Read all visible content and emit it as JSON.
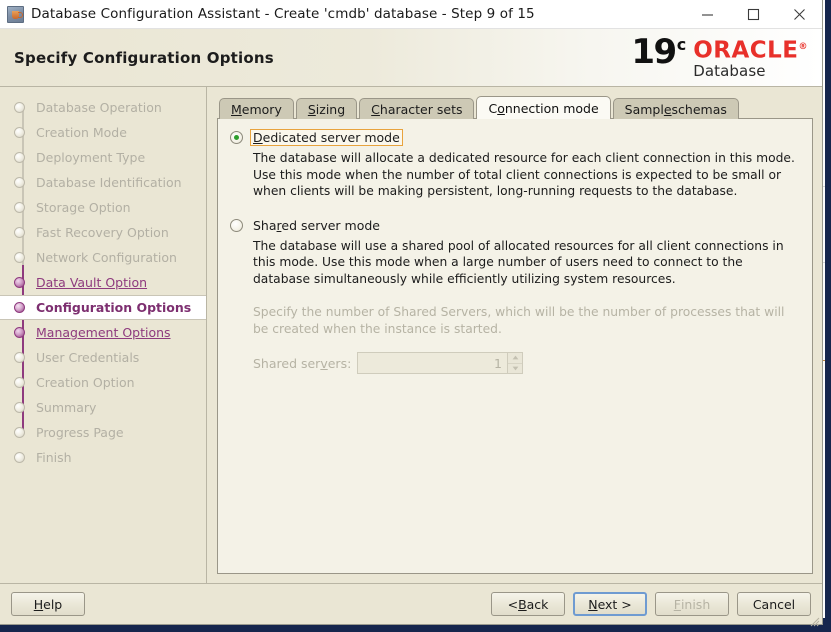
{
  "window": {
    "title": "Database Configuration Assistant - Create 'cmdb' database - Step 9 of 15",
    "app_icon": "java-coffee-cup-icon",
    "minimize_label": "—",
    "maximize_label": "□",
    "close_label": "✕"
  },
  "header": {
    "page_title": "Specify Configuration Options",
    "logo": {
      "version": "19",
      "version_sup": "c",
      "brand": "ORACLE",
      "brand_tm": "®",
      "product": "Database",
      "brand_color": "#e8302a"
    }
  },
  "sidebar": {
    "steps": [
      {
        "label": "Database Operation",
        "state": "done"
      },
      {
        "label": "Creation Mode",
        "state": "done"
      },
      {
        "label": "Deployment Type",
        "state": "done"
      },
      {
        "label": "Database Identification",
        "state": "done"
      },
      {
        "label": "Storage Option",
        "state": "done"
      },
      {
        "label": "Fast Recovery Option",
        "state": "done"
      },
      {
        "label": "Network Configuration",
        "state": "done"
      },
      {
        "label": "Data Vault Option",
        "state": "visited"
      },
      {
        "label": "Configuration Options",
        "state": "current"
      },
      {
        "label": "Management Options",
        "state": "visited"
      },
      {
        "label": "User Credentials",
        "state": "done"
      },
      {
        "label": "Creation Option",
        "state": "done"
      },
      {
        "label": "Summary",
        "state": "done"
      },
      {
        "label": "Progress Page",
        "state": "done"
      },
      {
        "label": "Finish",
        "state": "done"
      }
    ]
  },
  "tabs": [
    {
      "label": "Memory",
      "mnemonic": "M",
      "active": false
    },
    {
      "label": "Sizing",
      "mnemonic": "S",
      "active": false
    },
    {
      "label": "Character sets",
      "mnemonic": "C",
      "active": false
    },
    {
      "label": "Connection mode",
      "mnemonic": "o",
      "active": true
    },
    {
      "label": "Sample schemas",
      "mnemonic": "e",
      "active": false
    }
  ],
  "connection_mode": {
    "dedicated": {
      "label": "Dedicated server mode",
      "mnemonic": "D",
      "selected": true,
      "focused": true,
      "description": "The database will allocate a dedicated resource for each client connection in this mode. Use this mode when the number of total client connections is expected to be small or when clients will be making persistent, long-running requests to the database."
    },
    "shared": {
      "label": "Shared server mode",
      "mnemonic": "r",
      "selected": false,
      "description": "The database will use a shared pool of allocated resources for all client connections in this mode.  Use this mode when a large number of users need to connect to the database simultaneously while efficiently utilizing system resources.",
      "hint": "Specify the number of Shared Servers, which will be the number of processes that will be created when the instance is started.",
      "servers_label": "Shared servers:",
      "servers_mnemonic": "v",
      "servers_value": "1",
      "servers_disabled": true
    }
  },
  "footer": {
    "help": {
      "label": "Help",
      "mnemonic": "H",
      "disabled": false,
      "default": false
    },
    "back": {
      "label": "< Back",
      "mnemonic": "B",
      "disabled": false,
      "default": false
    },
    "next": {
      "label": "Next >",
      "mnemonic": "N",
      "disabled": false,
      "default": true
    },
    "finish": {
      "label": "Finish",
      "mnemonic": "F",
      "disabled": true,
      "default": false
    },
    "cancel": {
      "label": "Cancel",
      "mnemonic": "",
      "disabled": false,
      "default": false
    }
  }
}
